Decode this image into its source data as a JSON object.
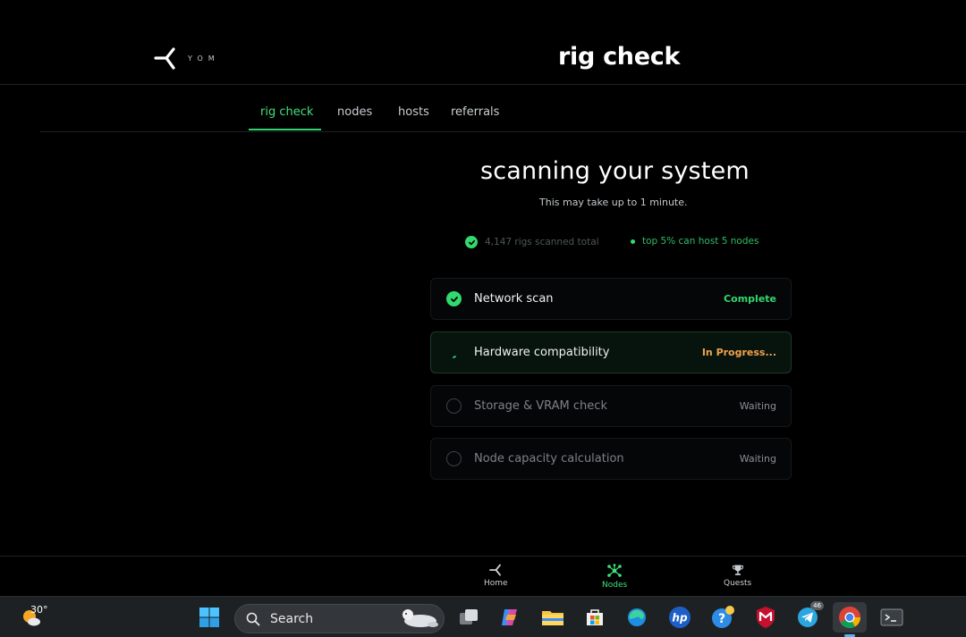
{
  "header": {
    "logo_text": "YOM",
    "title": "rig check"
  },
  "tabs": [
    {
      "label": "rig check",
      "active": true
    },
    {
      "label": "nodes",
      "active": false
    },
    {
      "label": "hosts",
      "active": false
    },
    {
      "label": "referrals",
      "active": false
    }
  ],
  "main": {
    "heading": "scanning your system",
    "subheading": "This may take up to 1 minute.",
    "stats": {
      "total": "4,147 rigs scanned total",
      "top": "top 5% can host 5 nodes"
    },
    "steps": [
      {
        "label": "Network scan",
        "status": "Complete",
        "state": "complete"
      },
      {
        "label": "Hardware compatibility",
        "status": "In Progress...",
        "state": "in-progress"
      },
      {
        "label": "Storage & VRAM check",
        "status": "Waiting",
        "state": "waiting"
      },
      {
        "label": "Node capacity calculation",
        "status": "Waiting",
        "state": "waiting"
      }
    ]
  },
  "bottom_nav": [
    {
      "label": "Home",
      "icon": "yom-logo-icon",
      "active": false
    },
    {
      "label": "Nodes",
      "icon": "network-nodes-icon",
      "active": true
    },
    {
      "label": "Quests",
      "icon": "trophy-icon",
      "active": false
    }
  ],
  "taskbar": {
    "weather_temp": "30°",
    "search_placeholder": "Search",
    "telegram_badge": "46"
  },
  "colors": {
    "accent_green": "#3ee27a",
    "progress_orange": "#f2a24b",
    "background": "#000000",
    "taskbar": "#1e2124"
  }
}
